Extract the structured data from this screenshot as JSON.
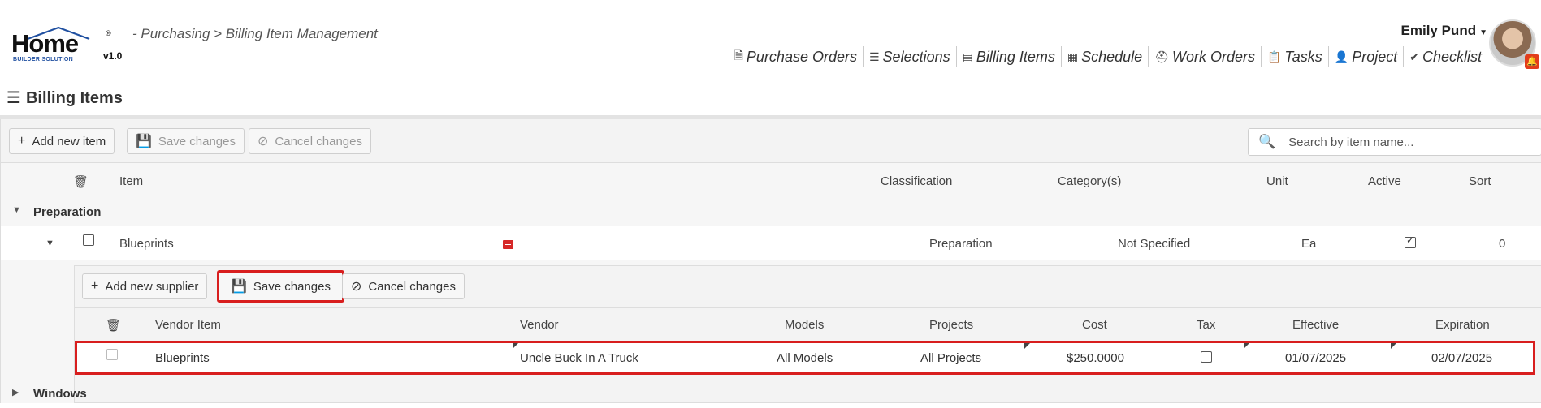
{
  "app": {
    "logo_text": "Home",
    "logo_sub": "BUILDER SOLUTION",
    "version": "v1.0",
    "registered": "®",
    "breadcrumb": "- Purchasing > Billing Item Management"
  },
  "user": {
    "name": "Emily Pund"
  },
  "nav": [
    {
      "label": "Purchase Orders",
      "icon": "document-icon"
    },
    {
      "label": "Selections",
      "icon": "checklist-icon"
    },
    {
      "label": "Billing Items",
      "icon": "ledger-icon"
    },
    {
      "label": "Schedule",
      "icon": "calendar-icon"
    },
    {
      "label": "Work Orders",
      "icon": "worker-icon"
    },
    {
      "label": "Tasks",
      "icon": "clipboard-icon"
    },
    {
      "label": "Project",
      "icon": "person-icon"
    },
    {
      "label": "Checklist",
      "icon": "checkmark-icon"
    }
  ],
  "page": {
    "title": "Billing Items"
  },
  "toolbar": {
    "add_label": "Add new item",
    "save_label": "Save changes",
    "cancel_label": "Cancel changes",
    "search_placeholder": "Search by item name..."
  },
  "columns": {
    "item": "Item",
    "classification": "Classification",
    "categories": "Category(s)",
    "unit": "Unit",
    "active": "Active",
    "sort": "Sort"
  },
  "groups": [
    {
      "label": "Preparation",
      "expanded": true
    },
    {
      "label": "Windows",
      "expanded": false
    }
  ],
  "item": {
    "name": "Blueprints",
    "classification": "Preparation",
    "categories": "Not Specified",
    "unit": "Ea",
    "active": true,
    "sort": "0"
  },
  "detail": {
    "toolbar": {
      "add_label": "Add new supplier",
      "save_label": "Save changes",
      "cancel_label": "Cancel changes"
    },
    "columns": {
      "vendor_item": "Vendor Item",
      "vendor": "Vendor",
      "models": "Models",
      "projects": "Projects",
      "cost": "Cost",
      "tax": "Tax",
      "effective": "Effective",
      "expiration": "Expiration"
    },
    "rows": [
      {
        "vendor_item": "Blueprints",
        "vendor": "Uncle Buck In A Truck",
        "models": "All Models",
        "projects": "All Projects",
        "cost": "$250.0000",
        "tax": false,
        "effective": "01/07/2025",
        "expiration": "02/07/2025"
      }
    ]
  },
  "colors": {
    "highlight": "#d81e1e",
    "accent_blue": "#1f4fa0",
    "notification": "#e23c1b"
  }
}
